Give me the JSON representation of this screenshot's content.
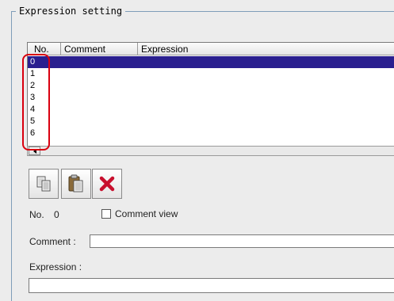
{
  "group_title": "Expression setting",
  "list": {
    "columns": [
      "No.",
      "Comment",
      "Expression"
    ],
    "rows": [
      "0",
      "1",
      "2",
      "3",
      "4",
      "5",
      "6"
    ],
    "selected_index": 0
  },
  "toolbar": {
    "copy_icon": "copy-icon",
    "paste_icon": "paste-icon",
    "delete_icon": "delete-icon"
  },
  "detail": {
    "no_label": "No.",
    "no_value": "0",
    "comment_view_label": "Comment view",
    "comment_view_checked": false,
    "comment_label": "Comment :",
    "comment_value": "",
    "expression_label": "Expression :",
    "expression_value": ""
  },
  "colors": {
    "selection": "#2a1f8f",
    "highlight_box": "#d9000f",
    "delete_icon": "#c8102e"
  }
}
